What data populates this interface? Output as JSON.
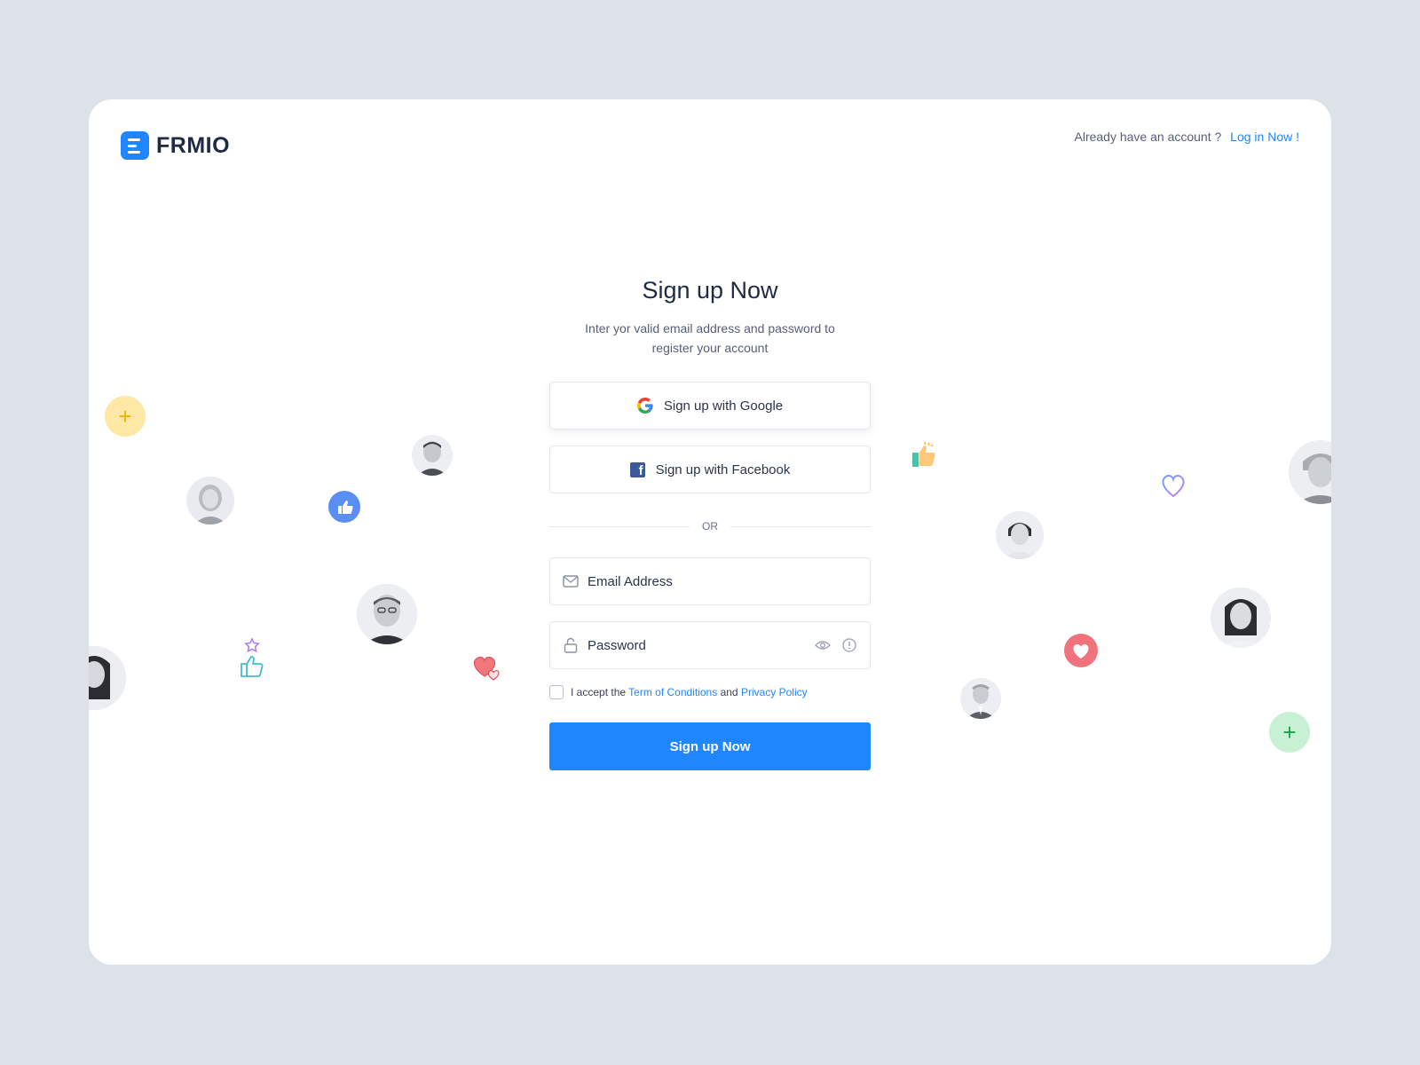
{
  "brand": {
    "name": "FRMIO",
    "color": "#1f86ff"
  },
  "header": {
    "prompt": "Already have an account ?",
    "login_link": "Log in Now !"
  },
  "form": {
    "title": "Sign up Now",
    "subtitle": "Inter yor valid email address and password to register your account",
    "google_button": "Sign up with Google",
    "facebook_button": "Sign up with Facebook",
    "divider_text": "OR",
    "email_placeholder": "Email Address",
    "password_placeholder": "Password",
    "terms": {
      "prefix": "I accept the",
      "terms_link": "Term of Conditions",
      "conjunction": "and",
      "privacy_link": "Privacy Policy"
    },
    "submit_button": "Sign up Now"
  },
  "icons": {
    "logo": "frmio-logo-icon",
    "google": "google-icon",
    "facebook": "facebook-icon",
    "email": "mail-icon",
    "password": "lock-icon",
    "show_password": "eye-icon",
    "info": "info-icon"
  },
  "decorations": {
    "plus_yellow": "+",
    "plus_green": "+"
  },
  "colors": {
    "primary": "#1f86ff",
    "background": "#dde1e8",
    "card": "#ffffff",
    "accent_yellow": "#ffe7a6",
    "accent_green": "#c8f0d2",
    "accent_red": "#f0727c"
  }
}
